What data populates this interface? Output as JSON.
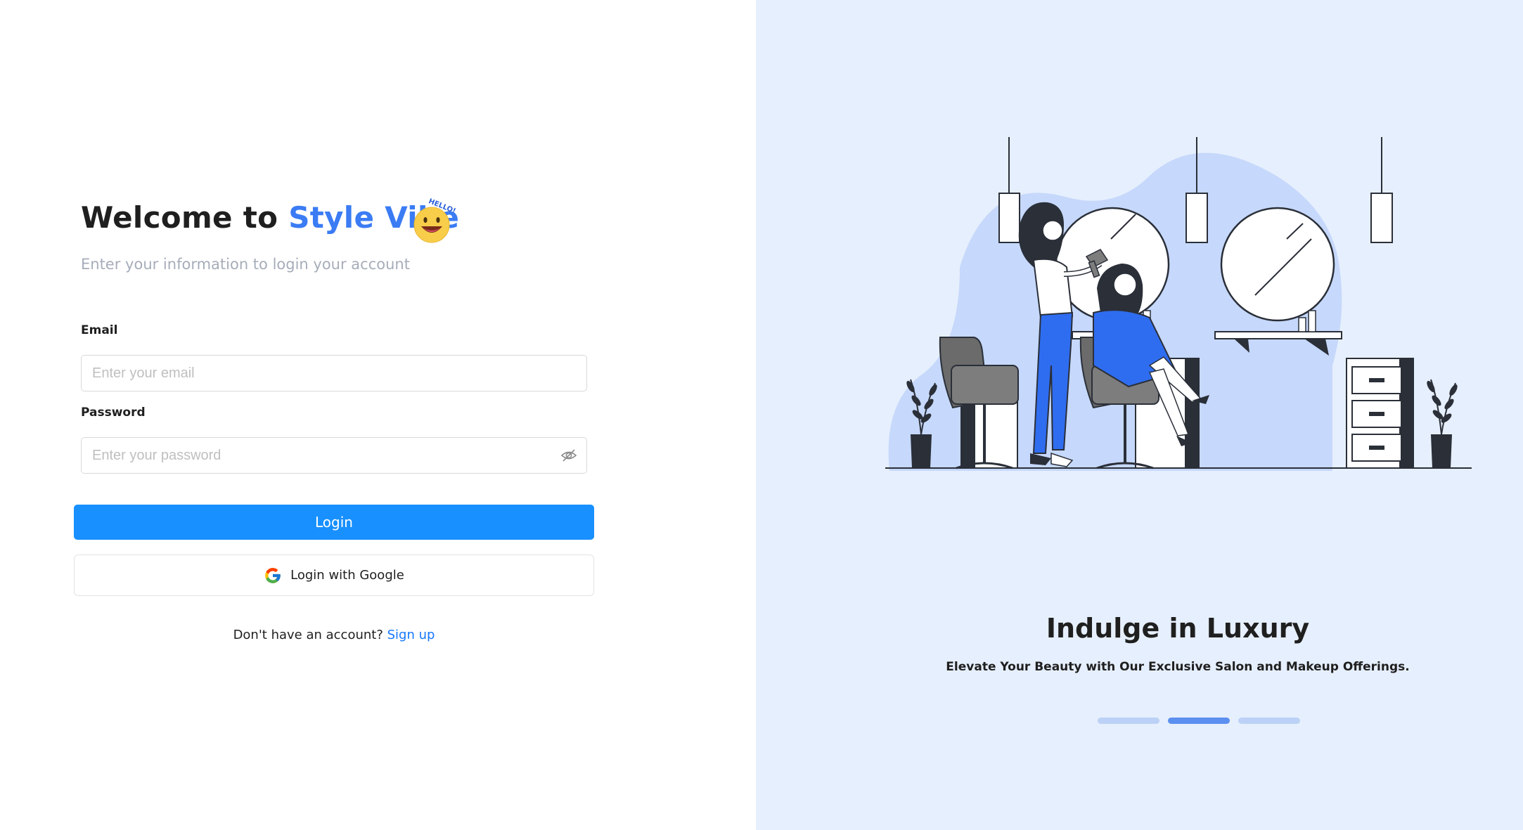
{
  "login": {
    "welcome_prefix": "Welcome to ",
    "brand_name": "Style Vibe",
    "emoji_text": "HELLO!",
    "subtitle": "Enter your information to login your account",
    "email_label": "Email",
    "email_placeholder": "Enter your email",
    "email_value": "",
    "password_label": "Password",
    "password_placeholder": "Enter your password",
    "password_value": "",
    "login_button": "Login",
    "google_button": "Login with Google",
    "signup_prompt": "Don't have an account? ",
    "signup_link": "Sign up"
  },
  "promo": {
    "title": "Indulge in Luxury",
    "subtitle": "Elevate Your Beauty with Our Exclusive Salon and Makeup Offerings.",
    "carousel_total": 3,
    "carousel_active": 2
  },
  "colors": {
    "brand": "#3b7cf4",
    "primary_button": "#1890ff",
    "right_panel_bg": "#e6effd",
    "illustration_accent": "#2f6df0"
  },
  "icons": [
    "hello-emoji-icon",
    "eye-off-icon",
    "google-icon"
  ]
}
